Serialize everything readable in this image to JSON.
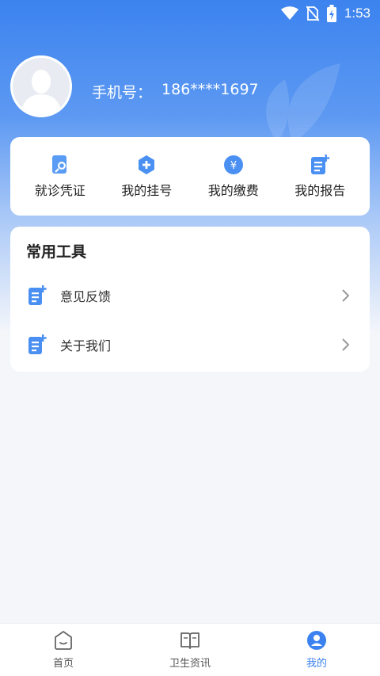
{
  "status_bar": {
    "time": "1:53"
  },
  "profile": {
    "phone_label": "手机号：",
    "phone_value": "186****1697"
  },
  "quick_actions": [
    {
      "label": "就诊凭证",
      "icon": "visit-certificate-icon"
    },
    {
      "label": "我的挂号",
      "icon": "registration-plus-icon"
    },
    {
      "label": "我的缴费",
      "icon": "payment-yen-icon"
    },
    {
      "label": "我的报告",
      "icon": "report-doc-icon"
    }
  ],
  "tools": {
    "title": "常用工具",
    "items": [
      {
        "label": "意见反馈",
        "icon": "feedback-doc-icon"
      },
      {
        "label": "关于我们",
        "icon": "about-doc-icon"
      }
    ]
  },
  "tabs": [
    {
      "label": "首页",
      "icon": "home-icon",
      "active": false
    },
    {
      "label": "卫生资讯",
      "icon": "book-icon",
      "active": false
    },
    {
      "label": "我的",
      "icon": "profile-icon",
      "active": true
    }
  ],
  "colors": {
    "primary": "#3b82f0",
    "background": "#f4f6fa"
  }
}
